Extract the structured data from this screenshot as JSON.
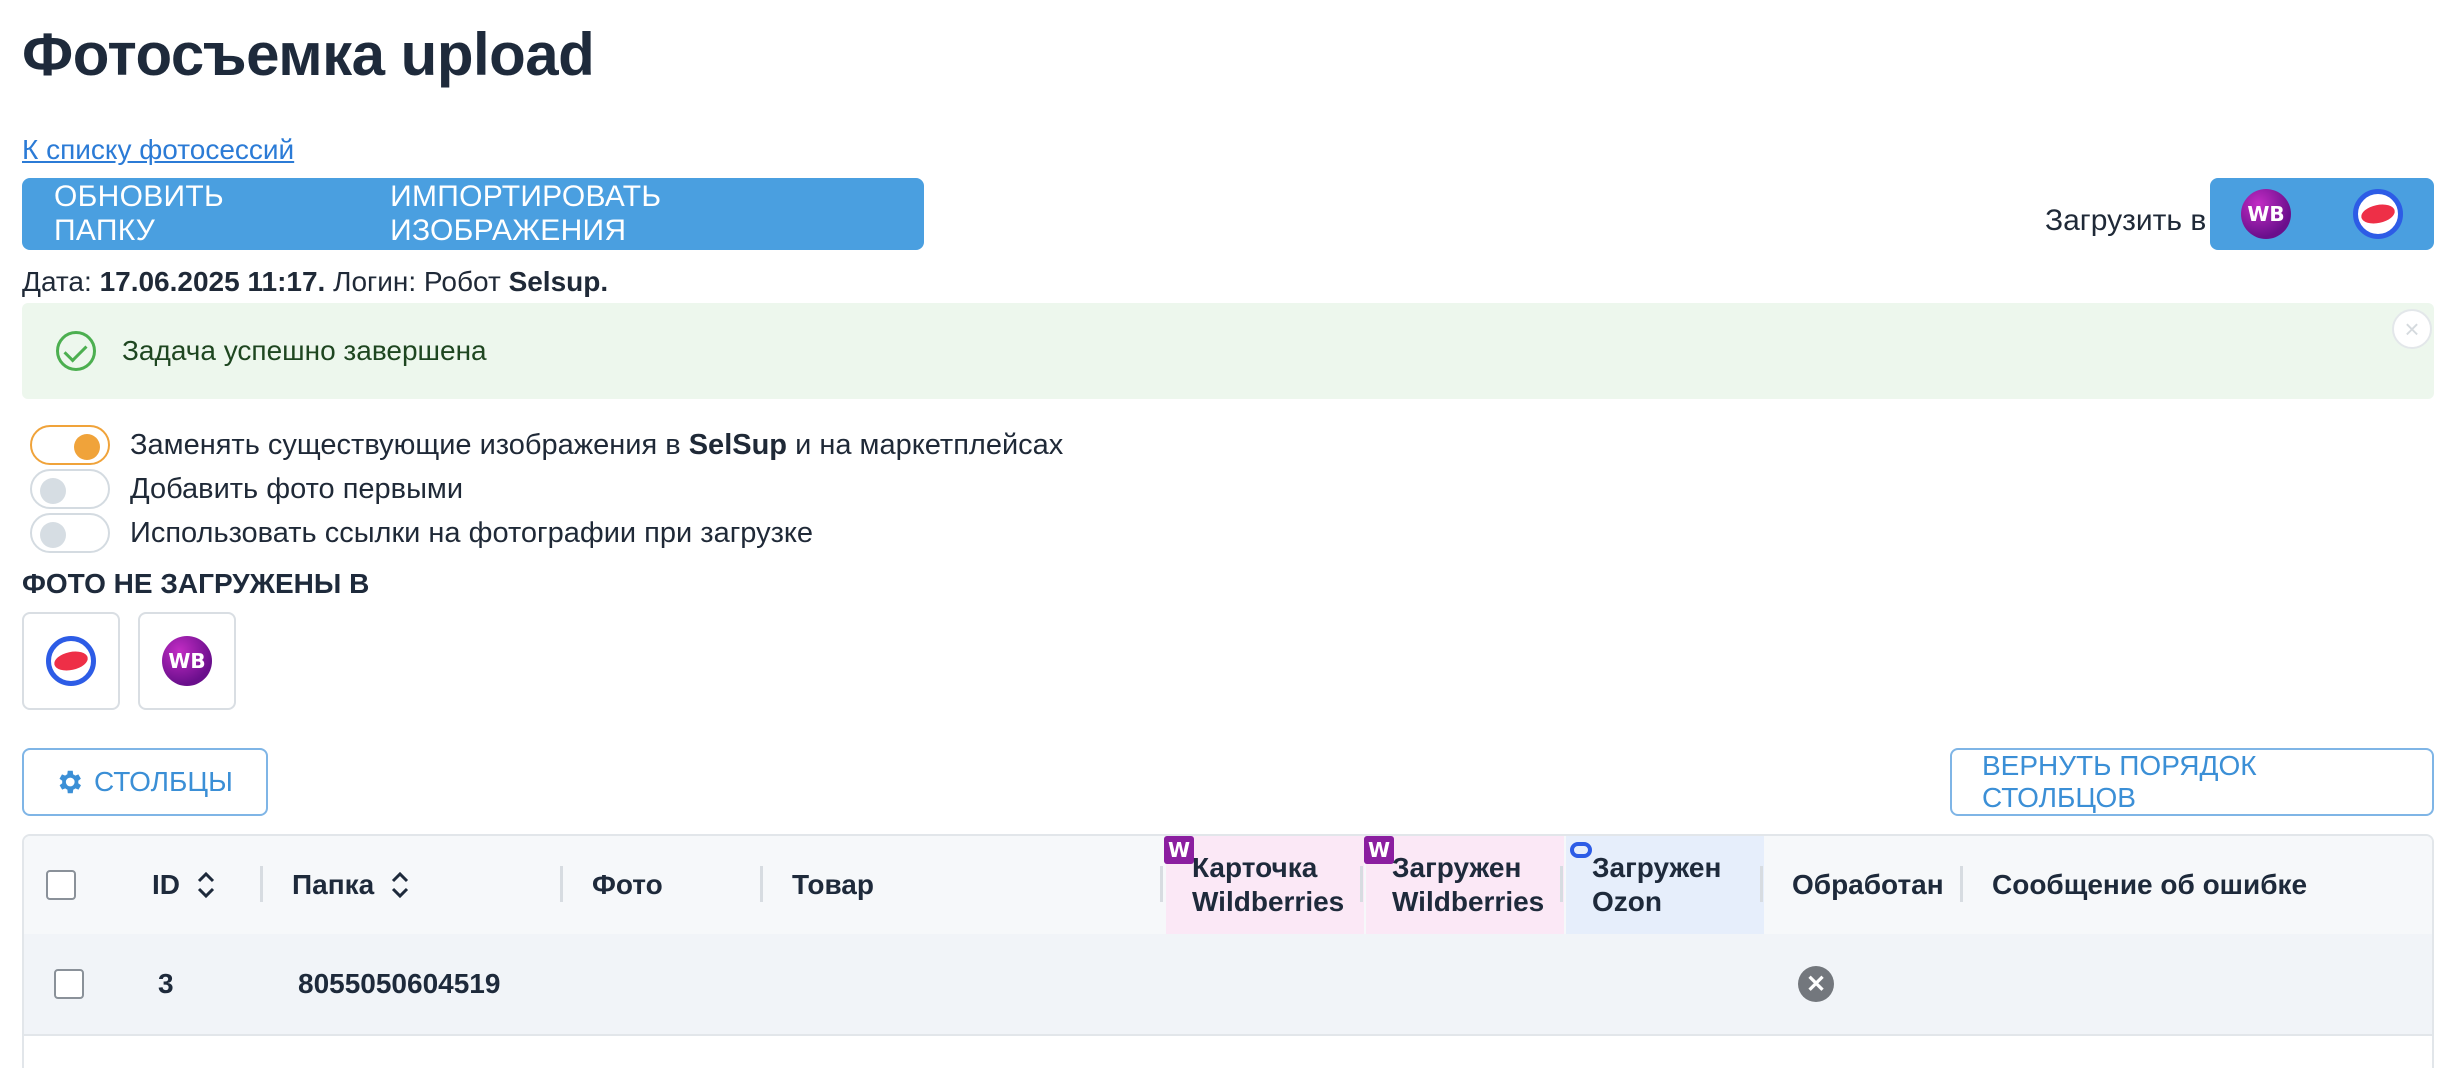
{
  "page": {
    "title": "Фотосъемка upload",
    "back_link": "К списку фотосессий"
  },
  "toolbar": {
    "refresh_label": "ОБНОВИТЬ ПАПКУ",
    "import_label": "ИМПОРТИРОВАТЬ ИЗОБРАЖЕНИЯ",
    "upload_to_label": "Загрузить в",
    "marketplaces": [
      "wildberries-logo-icon",
      "ozon-logo-icon"
    ],
    "wb_logo_text": "WB"
  },
  "meta": {
    "date_label": "Дата:",
    "date_value": "17.06.2025 11:17.",
    "login_label": "Логин: Робот",
    "login_value": "Selsup."
  },
  "alert": {
    "text": "Задача успешно завершена",
    "close_glyph": "×"
  },
  "options": [
    {
      "label_pre": "Заменять существующие изображения в ",
      "label_bold": "SelSup",
      "label_post": " и на маркетплейсах",
      "checked": true
    },
    {
      "label_pre": "Добавить фото первыми",
      "label_bold": "",
      "label_post": "",
      "checked": false
    },
    {
      "label_pre": "Использовать ссылки на фотографии при загрузке",
      "label_bold": "",
      "label_post": "",
      "checked": false
    }
  ],
  "not_uploaded": {
    "title": "ФОТО НЕ ЗАГРУЖЕНЫ В",
    "marketplaces": [
      "ozon-logo-icon",
      "wildberries-logo-icon"
    ]
  },
  "columns_button": "СТОЛБЦЫ",
  "reset_columns_button": "ВЕРНУТЬ ПОРЯДОК СТОЛБЦОВ",
  "table": {
    "headers": {
      "id": "ID",
      "folder": "Папка",
      "photo": "Фото",
      "product": "Товар",
      "wb_card_1": "Карточка",
      "wb_card_2": "Wildberries",
      "wb_loaded_1": "Загружен",
      "wb_loaded_2": "Wildberries",
      "ozon_loaded_1": "Загружен",
      "ozon_loaded_2": "Ozon",
      "processed": "Обработан",
      "error": "Сообщение об ошибке"
    },
    "badges": {
      "wb": "W"
    },
    "rows": [
      {
        "id": "3",
        "folder": "8055050604519",
        "photo": "",
        "product": "",
        "processed": "no",
        "processed_glyph": "✕",
        "error": ""
      }
    ]
  },
  "colors": {
    "primary": "#4a9fe0",
    "success_bg": "#edf7ed",
    "toggle_on": "#f0a33a",
    "wb_col_bg": "#fbe8f6",
    "ozon_col_bg": "#e6eefb"
  }
}
